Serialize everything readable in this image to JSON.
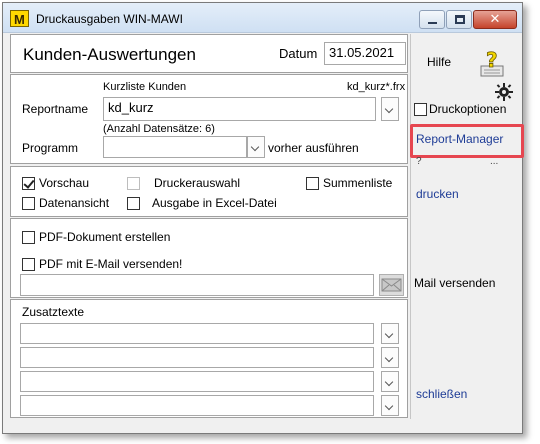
{
  "window": {
    "title": "Druckausgaben  WIN-MAWI",
    "app_icon_letter": "M",
    "close_glyph": "✕"
  },
  "header": {
    "heading": "Kunden-Auswertungen",
    "date_label": "Datum",
    "date_value": "31.05.2021"
  },
  "report": {
    "short_list_label": "Kurzliste Kunden",
    "file_label": "kd_kurz*.frx",
    "name_label": "Reportname",
    "name_value": "kd_kurz",
    "count_text": "(Anzahl Datensätze: 6)",
    "program_label": "Programm",
    "program_value": "",
    "run_before_label": "vorher ausführen"
  },
  "options": {
    "preview": {
      "label": "Vorschau",
      "checked": true
    },
    "printer_select": {
      "label": "Druckerauswahl",
      "checked": false,
      "disabled": true
    },
    "sum_list": {
      "label": "Summenliste",
      "checked": false
    },
    "data_view": {
      "label": "Datenansicht",
      "checked": false
    },
    "excel_output": {
      "label": "Ausgabe in Excel-Datei",
      "checked": false
    }
  },
  "pdf": {
    "create_pdf": {
      "label": "PDF-Dokument erstellen",
      "checked": false
    },
    "send_pdf": {
      "label": "PDF mit E-Mail versenden!",
      "checked": false
    },
    "path_value": ""
  },
  "extra_texts": {
    "label": "Zusatztexte",
    "rows": [
      "",
      "",
      "",
      ""
    ]
  },
  "sidebar": {
    "help_label": "Hilfe",
    "print_options_label": "Druckoptionen",
    "report_manager_label": "Report-Manager",
    "question_mark": "?",
    "ellipsis": "...",
    "print_label": "drucken",
    "mail_label": "Mail versenden",
    "close_label": "schließen"
  },
  "colors": {
    "highlight": "#e64650",
    "link": "#1e3c96"
  }
}
